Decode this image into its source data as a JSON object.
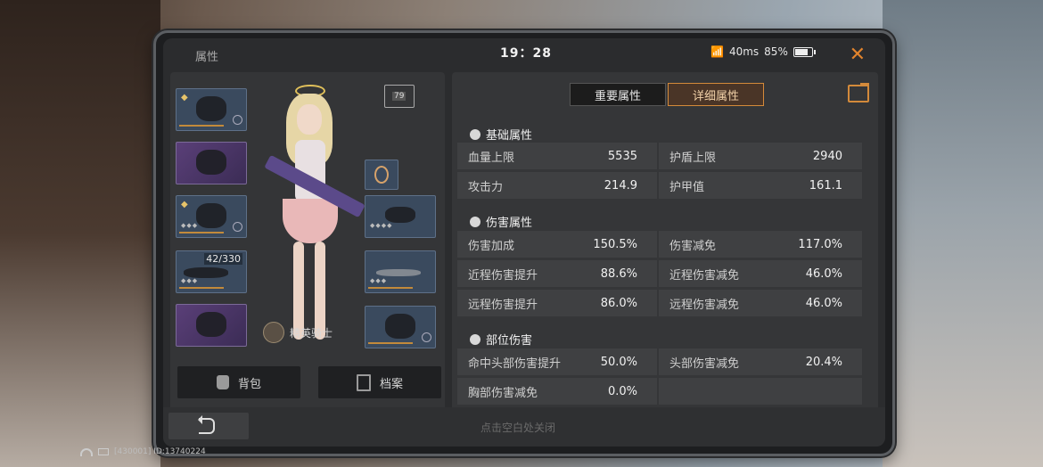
{
  "header": {
    "title": "属性",
    "time": "19：28",
    "ping": "40ms",
    "battery": "85%"
  },
  "equipment": {
    "ammo": "42/330",
    "rank_level": "79",
    "rank_name": "精英骑士",
    "slots_left": [
      "helmet",
      "armor",
      "suit",
      "rifle",
      "pet"
    ],
    "slots_right": [
      "ring",
      "bracelet",
      "knife",
      "drone"
    ]
  },
  "buttons": {
    "bag": "背包",
    "archive": "档案"
  },
  "tabs": {
    "important": "重要属性",
    "detail": "详细属性"
  },
  "sections": {
    "basic": {
      "title": "基础属性",
      "rows": [
        {
          "label": "血量上限",
          "value": "5535",
          "label2": "护盾上限",
          "value2": "2940"
        },
        {
          "label": "攻击力",
          "value": "214.9",
          "label2": "护甲值",
          "value2": "161.1"
        }
      ]
    },
    "damage": {
      "title": "伤害属性",
      "rows": [
        {
          "label": "伤害加成",
          "value": "150.5%",
          "label2": "伤害减免",
          "value2": "117.0%"
        },
        {
          "label": "近程伤害提升",
          "value": "88.6%",
          "label2": "近程伤害减免",
          "value2": "46.0%"
        },
        {
          "label": "远程伤害提升",
          "value": "86.0%",
          "label2": "远程伤害减免",
          "value2": "46.0%"
        }
      ]
    },
    "parts": {
      "title": "部位伤害",
      "rows": [
        {
          "label": "命中头部伤害提升",
          "value": "50.0%",
          "label2": "头部伤害减免",
          "value2": "20.4%"
        },
        {
          "label": "胸部伤害减免",
          "value": "0.0%"
        }
      ]
    }
  },
  "bottom": {
    "hint": "点击空白处关闭"
  },
  "footer": {
    "id_text": "[430001] ID:13740224"
  },
  "colors": {
    "accent": "#e2842d",
    "tab_active_border": "#d48a3a"
  }
}
